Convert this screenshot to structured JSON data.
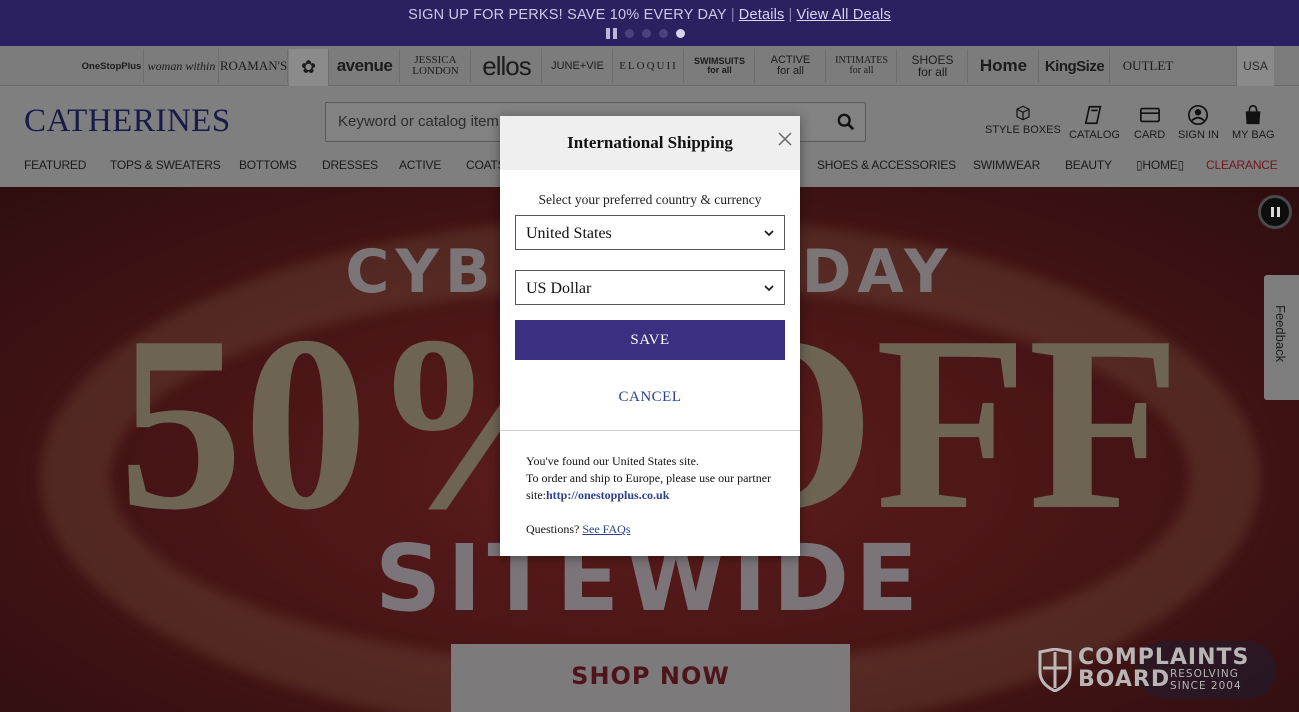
{
  "promo": {
    "text": "SIGN UP FOR PERKS! SAVE 10% EVERY DAY",
    "details_link": "Details",
    "all_deals_link": "View All Deals"
  },
  "brands": [
    {
      "label": "OneStopPlus"
    },
    {
      "label": "woman within"
    },
    {
      "label": "ROAMAN'S"
    },
    {
      "label": "✿"
    },
    {
      "label": "avenue"
    },
    {
      "label": "JESSICA LONDON"
    },
    {
      "label": "ellos"
    },
    {
      "label": "JUNE+VIE"
    },
    {
      "label": "ELOQUII"
    },
    {
      "label": "SWIMSUITS for all"
    },
    {
      "label": "ACTIVE for all"
    },
    {
      "label": "INTIMATES for all"
    },
    {
      "label": "SHOES for all"
    },
    {
      "label": "Home"
    },
    {
      "label": "KingSize"
    },
    {
      "label": "OUTLET"
    }
  ],
  "locale_button": "USA",
  "header": {
    "logo": "CATHERINES",
    "search_placeholder": "Keyword or catalog item",
    "utilities": {
      "style_boxes": "STYLE BOXES",
      "catalog": "CATALOG",
      "card": "CARD",
      "sign_in": "SIGN IN",
      "my_bag": "MY BAG"
    }
  },
  "nav": {
    "featured": "FEATURED",
    "tops": "TOPS & SWEATERS",
    "bottoms": "BOTTOMS",
    "dresses": "DRESSES",
    "active": "ACTIVE",
    "coats": "COATS",
    "shoes": "SHOES & ACCESSORIES",
    "swimwear": "SWIMWEAR",
    "beauty": "BEAUTY",
    "home": "▯HOME▯",
    "clearance": "CLEARANCE"
  },
  "hero": {
    "line1": "CYBER MONDAY",
    "line2": "50% OFF",
    "line3": "SITEWIDE",
    "cta": "SHOP NOW"
  },
  "feedback_tab": "Feedback",
  "complaints_badge": {
    "title_line1": "COMPLAINTS",
    "title_line2": "BOARD",
    "sub_line1": "RESOLVING",
    "sub_line2": "SINCE 2004"
  },
  "modal": {
    "title": "International Shipping",
    "prompt": "Select your preferred country & currency",
    "country_value": "United States",
    "currency_value": "US Dollar",
    "save_label": "SAVE",
    "cancel_label": "CANCEL",
    "info_line1": "You've found our United States site.",
    "info_line2": "To order and ship to Europe, please use our partner site:",
    "partner_link": "http://onestopplus.co.uk",
    "questions_label": "Questions?",
    "faq_link": "See FAQs"
  }
}
